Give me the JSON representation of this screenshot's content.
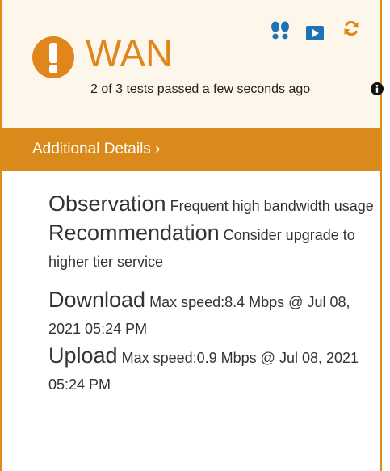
{
  "header": {
    "title": "WAN",
    "subtitle": "2 of 3 tests passed a few seconds ago",
    "status_color": "#e0861c",
    "icons": [
      "alert-icon",
      "footprints-icon",
      "play-icon",
      "refresh-icon",
      "info-icon"
    ]
  },
  "details_bar": {
    "label": "Additional Details ›",
    "color": "#d98a1a"
  },
  "observation": {
    "heading": "Observation",
    "text": "Frequent high bandwidth usage"
  },
  "recommendation": {
    "heading": "Recommendation",
    "text": "Consider upgrade to higher tier service"
  },
  "download": {
    "heading": "Download",
    "text": "Max speed:8.4 Mbps @ Jul 08, 2021 05:24 PM"
  },
  "upload": {
    "heading": "Upload",
    "text": "Max speed:0.9 Mbps @ Jul 08, 2021 05:24 PM"
  }
}
